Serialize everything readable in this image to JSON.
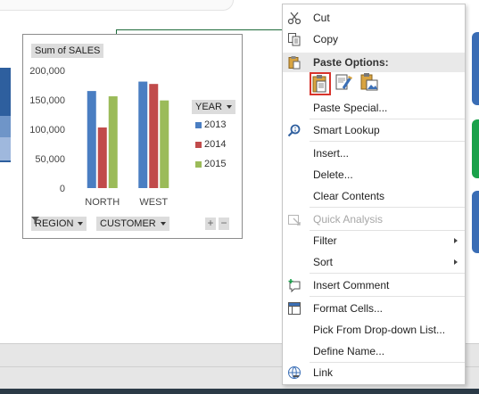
{
  "chart": {
    "value_field": "Sum of SALES",
    "legend_field": "YEAR",
    "axis_field_1": "REGION",
    "axis_field_2": "CUSTOMER",
    "zoom_in": "+",
    "zoom_out": "−"
  },
  "chart_data": {
    "type": "bar",
    "categories": [
      "NORTH",
      "WEST"
    ],
    "series": [
      {
        "name": "2013",
        "values": [
          165000,
          181000
        ],
        "color": "#4a7ec2"
      },
      {
        "name": "2014",
        "values": [
          103000,
          177000
        ],
        "color": "#c14b4b"
      },
      {
        "name": "2015",
        "values": [
          156000,
          149000
        ],
        "color": "#9bbb59"
      }
    ],
    "yticks": [
      "0",
      "50,000",
      "100,000",
      "150,000",
      "200,000"
    ],
    "ylim": [
      0,
      200000
    ],
    "title": "Sum of SALES",
    "legend_title": "YEAR",
    "legend_position": "right",
    "grid": false
  },
  "menu": {
    "cut": "Cut",
    "copy": "Copy",
    "paste_options": "Paste Options:",
    "paste_special": "Paste Special...",
    "smart_lookup": "Smart Lookup",
    "insert": "Insert...",
    "delete": "Delete...",
    "clear_contents": "Clear Contents",
    "quick_analysis": "Quick Analysis",
    "filter": "Filter",
    "sort": "Sort",
    "insert_comment": "Insert Comment",
    "format_cells": "Format Cells...",
    "pick_dropdown": "Pick From Drop-down List...",
    "define_name": "Define Name...",
    "link": "Link"
  },
  "icons": {
    "cut": "scissors-icon",
    "copy": "copy-icon",
    "paste": "clipboard-icon",
    "smart_lookup": "magnifier-icon",
    "quick_analysis": "quick-analysis-icon",
    "insert_comment": "comment-icon",
    "format_cells": "format-cells-icon",
    "link": "link-icon"
  },
  "colors": {
    "accent_selection": "#d8342c",
    "menu_icon_blue": "#3b6fb6"
  }
}
